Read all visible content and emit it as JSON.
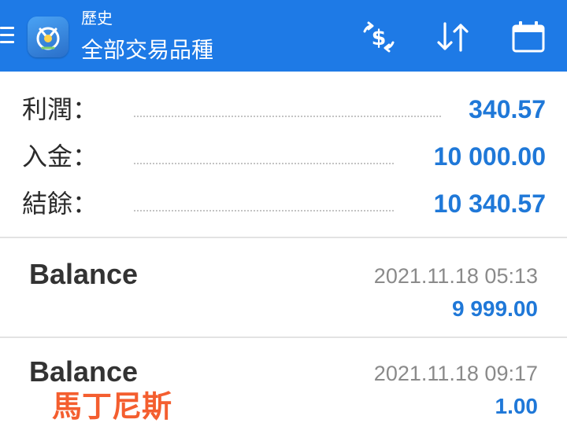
{
  "header": {
    "title_small": "歷史",
    "title_large": "全部交易品種",
    "icons": {
      "menu": "menu-icon",
      "logo": "app-logo-icon",
      "exchange": "currency-exchange-icon",
      "sort": "sort-arrows-icon",
      "calendar": "calendar-icon"
    }
  },
  "summary": {
    "rows": [
      {
        "label": "利潤：",
        "value": "340.57"
      },
      {
        "label": "入金：",
        "value": "10 000.00"
      },
      {
        "label": "結餘：",
        "value": "10 340.57"
      }
    ]
  },
  "deals": [
    {
      "type": "Balance",
      "time": "2021.11.18 05:13",
      "amount": "9 999.00"
    },
    {
      "type": "Balance",
      "time": "2021.11.18 09:17",
      "amount": "1.00"
    }
  ],
  "overlay_text": "馬丁尼斯",
  "colors": {
    "appbar": "#1e7ae6",
    "value_blue": "#1f78d8",
    "overlay": "#f45e2f"
  }
}
